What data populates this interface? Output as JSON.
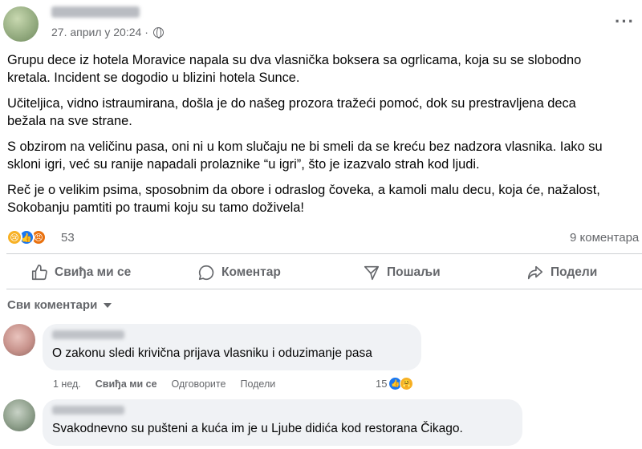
{
  "post": {
    "timestamp": "27. април у 20:24 ·",
    "paragraphs": [
      "Grupu dece iz hotela Moravice napala su dva vlasnička boksera sa ogrlicama, koja su se slobodno",
      "kretala. Incident se dogodio u blizini hotela Sunce.",
      "Učiteljica, vidno istraumirana, došla je do našeg prozora tražeći pomoć, dok su prestravljena deca",
      "bežala na sve strane.",
      "S obzirom na veličinu pasa, oni ni u kom slučaju ne bi smeli da se kreću bez nadzora vlasnika. Iako su",
      "skloni igri, već su ranije napadali prolaznike “u igri”, što je izazvalo strah kod ljudi.",
      "Reč je o velikim psima, sposobnim da obore i odraslog čoveka, a kamoli malu decu, koja će, nažalost,",
      "Sokobanju pamtiti po traumi koju su tamo doživela!"
    ],
    "reaction_count": "53",
    "comment_count": "9 коментара"
  },
  "actions": {
    "like": "Свиђа ми се",
    "comment": "Коментар",
    "send": "Пошаљи",
    "share": "Подели"
  },
  "comments_header": "Сви коментари",
  "comments": [
    {
      "text": "O zakonu sledi krivična prijava vlasniku i oduzimanje pasa",
      "time": "1 нед.",
      "like": "Свиђа ми се",
      "reply": "Одговорите",
      "share": "Подели",
      "reaction_count": "15"
    },
    {
      "text": "Svakodnevno su pušteni a kuća im je u Ljube didića kod restorana Čikago."
    }
  ],
  "colors": {
    "secondary_text": "#65676b",
    "like_blue": "#1877f2",
    "bubble_bg": "#f0f2f5"
  }
}
